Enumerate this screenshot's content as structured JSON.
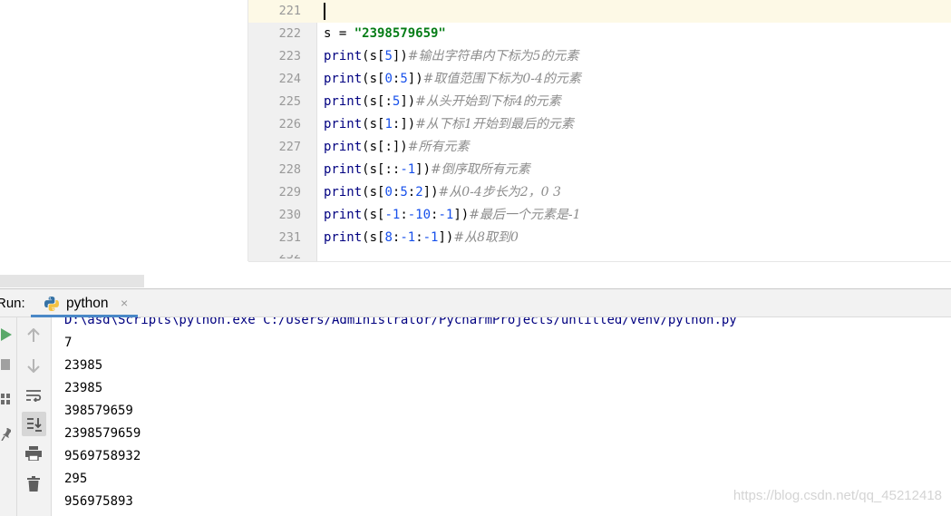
{
  "editor": {
    "lines": [
      {
        "num": "221",
        "parts": []
      },
      {
        "num": "222",
        "parts": [
          {
            "t": "s = ",
            "c": ""
          },
          {
            "t": "\"2398579659\"",
            "c": "str"
          }
        ]
      },
      {
        "num": "223",
        "parts": [
          {
            "t": "print",
            "c": "kw"
          },
          {
            "t": "(s[",
            "c": ""
          },
          {
            "t": "5",
            "c": "num"
          },
          {
            "t": "])",
            "c": ""
          },
          {
            "t": "#输出字符串内下标为5的元素",
            "c": "cmt"
          }
        ]
      },
      {
        "num": "224",
        "parts": [
          {
            "t": "print",
            "c": "kw"
          },
          {
            "t": "(s[",
            "c": ""
          },
          {
            "t": "0",
            "c": "num"
          },
          {
            "t": ":",
            "c": ""
          },
          {
            "t": "5",
            "c": "num"
          },
          {
            "t": "])",
            "c": ""
          },
          {
            "t": "#取值范围下标为0-4的元素",
            "c": "cmt"
          }
        ]
      },
      {
        "num": "225",
        "parts": [
          {
            "t": "print",
            "c": "kw"
          },
          {
            "t": "(s[:",
            "c": ""
          },
          {
            "t": "5",
            "c": "num"
          },
          {
            "t": "])",
            "c": ""
          },
          {
            "t": "#从头开始到下标4的元素",
            "c": "cmt"
          }
        ]
      },
      {
        "num": "226",
        "parts": [
          {
            "t": "print",
            "c": "kw"
          },
          {
            "t": "(s[",
            "c": ""
          },
          {
            "t": "1",
            "c": "num"
          },
          {
            "t": ":])",
            "c": ""
          },
          {
            "t": "#从下标1开始到最后的元素",
            "c": "cmt"
          }
        ]
      },
      {
        "num": "227",
        "parts": [
          {
            "t": "print",
            "c": "kw"
          },
          {
            "t": "(s[:])",
            "c": ""
          },
          {
            "t": "#所有元素",
            "c": "cmt"
          }
        ]
      },
      {
        "num": "228",
        "parts": [
          {
            "t": "print",
            "c": "kw"
          },
          {
            "t": "(s[::",
            "c": ""
          },
          {
            "t": "-1",
            "c": "num"
          },
          {
            "t": "])",
            "c": ""
          },
          {
            "t": "#倒序取所有元素",
            "c": "cmt"
          }
        ]
      },
      {
        "num": "229",
        "parts": [
          {
            "t": "print",
            "c": "kw"
          },
          {
            "t": "(s[",
            "c": ""
          },
          {
            "t": "0",
            "c": "num"
          },
          {
            "t": ":",
            "c": ""
          },
          {
            "t": "5",
            "c": "num"
          },
          {
            "t": ":",
            "c": ""
          },
          {
            "t": "2",
            "c": "num"
          },
          {
            "t": "])",
            "c": ""
          },
          {
            "t": "#从0-4步长为2，0 3",
            "c": "cmt"
          }
        ]
      },
      {
        "num": "230",
        "parts": [
          {
            "t": "print",
            "c": "kw"
          },
          {
            "t": "(s[",
            "c": ""
          },
          {
            "t": "-1",
            "c": "num"
          },
          {
            "t": ":",
            "c": ""
          },
          {
            "t": "-10",
            "c": "num"
          },
          {
            "t": ":",
            "c": ""
          },
          {
            "t": "-1",
            "c": "num"
          },
          {
            "t": "])",
            "c": ""
          },
          {
            "t": "#最后一个元素是-1",
            "c": "cmt"
          }
        ]
      },
      {
        "num": "231",
        "parts": [
          {
            "t": "print",
            "c": "kw"
          },
          {
            "t": "(s[",
            "c": ""
          },
          {
            "t": "8",
            "c": "num"
          },
          {
            "t": ":",
            "c": ""
          },
          {
            "t": "-1",
            "c": "num"
          },
          {
            "t": ":",
            "c": ""
          },
          {
            "t": "-1",
            "c": "num"
          },
          {
            "t": "])",
            "c": ""
          },
          {
            "t": "#从8取到0",
            "c": "cmt"
          }
        ]
      }
    ],
    "cut_line_num": "232"
  },
  "run": {
    "label": "Run:",
    "tab_label": "python",
    "close_glyph": "×"
  },
  "console": {
    "command": "D:\\asd\\Scripts\\python.exe C:/Users/Administrator/PycharmProjects/untitled/venv/python.py",
    "output": [
      "7",
      "23985",
      "23985",
      "398579659",
      "2398579659",
      "9569758932",
      "295",
      "956975893"
    ]
  },
  "watermark": "https://blog.csdn.net/qq_45212418",
  "colors": {
    "keyword": "#000080",
    "string": "#067d17",
    "number": "#1750eb",
    "comment": "#8c8c8c",
    "run_green": "#59a869",
    "tab_underline": "#4a88c7"
  }
}
